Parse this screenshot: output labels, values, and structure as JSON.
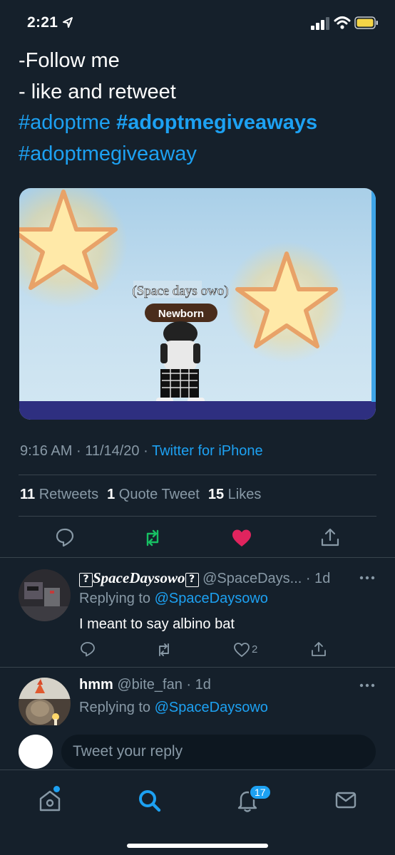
{
  "status_bar": {
    "time": "2:21",
    "icons": [
      "location-arrow-icon",
      "cellular-signal-icon",
      "wifi-icon",
      "battery-icon"
    ],
    "battery_color": "#f5d547"
  },
  "tweet": {
    "lines": [
      "-Follow me",
      "- like and retweet"
    ],
    "hashtag_1": "#adoptme",
    "hashtag_2": "#adoptmegiveaways",
    "hashtag_3": "#adoptmegiveaway",
    "media": {
      "caption": "(Space days owo)",
      "nameplate": "Newborn"
    },
    "time": "9:16 AM",
    "date": "11/14/20",
    "separator": "·",
    "source": "Twitter for iPhone",
    "stats": {
      "retweets_count": "11",
      "retweets_label": "Retweets",
      "quotes_count": "1",
      "quotes_label": "Quote Tweet",
      "likes_count": "15",
      "likes_label": "Likes"
    },
    "actions": [
      "reply-icon",
      "retweet-icon",
      "like-icon",
      "share-icon"
    ],
    "retweet_color": "#17bf63",
    "like_color": "#e0245e"
  },
  "replies": [
    {
      "display_name": "SpaceDaysowo",
      "name_glyph": "?",
      "handle": "@SpaceDays...",
      "age": "· 1d",
      "replying_prefix": "Replying to",
      "replying_handle": "@SpaceDaysowo",
      "body": "I meant to say albino bat",
      "like_count": "2"
    },
    {
      "display_name": "hmm",
      "handle": "@bite_fan",
      "age": "· 1d",
      "replying_prefix": "Replying to",
      "replying_handle": "@SpaceDaysowo"
    }
  ],
  "composer": {
    "placeholder": "Tweet your reply"
  },
  "tabbar": {
    "tabs": [
      "home-icon",
      "search-icon",
      "notifications-icon",
      "messages-icon"
    ],
    "notifications_badge": "17",
    "accent": "#1da1f2"
  }
}
